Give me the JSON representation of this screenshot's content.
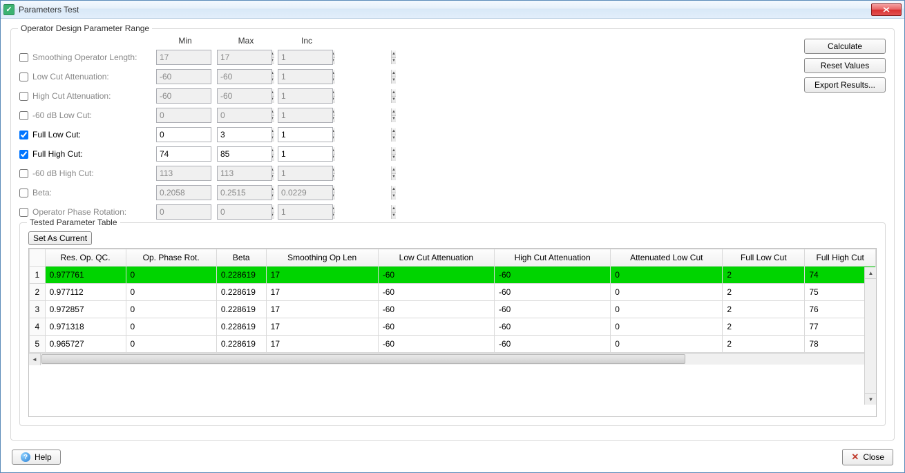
{
  "window": {
    "title": "Parameters Test"
  },
  "group_title": "Operator Design Parameter Range",
  "table_group_title": "Tested Parameter Table",
  "headers": {
    "min": "Min",
    "max": "Max",
    "inc": "Inc"
  },
  "buttons": {
    "calculate": "Calculate",
    "reset": "Reset Values",
    "export": "Export Results...",
    "set_current": "Set As Current",
    "help": "Help",
    "close": "Close"
  },
  "params": [
    {
      "label": "Smoothing Operator Length:",
      "checked": false,
      "min": "17",
      "max": "17",
      "inc": "1",
      "enabled": false
    },
    {
      "label": "Low Cut Attenuation:",
      "checked": false,
      "min": "-60",
      "max": "-60",
      "inc": "1",
      "enabled": false
    },
    {
      "label": "High Cut Attenuation:",
      "checked": false,
      "min": "-60",
      "max": "-60",
      "inc": "1",
      "enabled": false
    },
    {
      "label": "-60 dB Low Cut:",
      "checked": false,
      "min": "0",
      "max": "0",
      "inc": "1",
      "enabled": false
    },
    {
      "label": "Full Low Cut:",
      "checked": true,
      "min": "0",
      "max": "3",
      "inc": "1",
      "enabled": true
    },
    {
      "label": "Full High Cut:",
      "checked": true,
      "min": "74",
      "max": "85",
      "inc": "1",
      "enabled": true
    },
    {
      "label": "-60 dB High Cut:",
      "checked": false,
      "min": "113",
      "max": "113",
      "inc": "1",
      "enabled": false
    },
    {
      "label": "Beta:",
      "checked": false,
      "min": "0.2058",
      "max": "0.2515",
      "inc": "0.0229",
      "enabled": false
    },
    {
      "label": "Operator Phase Rotation:",
      "checked": false,
      "min": "0",
      "max": "0",
      "inc": "1",
      "enabled": false
    }
  ],
  "table": {
    "cols": [
      "Res. Op. QC.",
      "Op. Phase Rot.",
      "Beta",
      "Smoothing Op Len",
      "Low Cut Attenuation",
      "High Cut Attenuation",
      "Attenuated Low Cut",
      "Full Low Cut",
      "Full High Cut"
    ],
    "rows": [
      {
        "n": "1",
        "sel": true,
        "cells": [
          "0.977761",
          "0",
          "0.228619",
          "17",
          "-60",
          "-60",
          "0",
          "2",
          "74"
        ]
      },
      {
        "n": "2",
        "sel": false,
        "cells": [
          "0.977112",
          "0",
          "0.228619",
          "17",
          "-60",
          "-60",
          "0",
          "2",
          "75"
        ]
      },
      {
        "n": "3",
        "sel": false,
        "cells": [
          "0.972857",
          "0",
          "0.228619",
          "17",
          "-60",
          "-60",
          "0",
          "2",
          "76"
        ]
      },
      {
        "n": "4",
        "sel": false,
        "cells": [
          "0.971318",
          "0",
          "0.228619",
          "17",
          "-60",
          "-60",
          "0",
          "2",
          "77"
        ]
      },
      {
        "n": "5",
        "sel": false,
        "cells": [
          "0.965727",
          "0",
          "0.228619",
          "17",
          "-60",
          "-60",
          "0",
          "2",
          "78"
        ]
      }
    ]
  }
}
